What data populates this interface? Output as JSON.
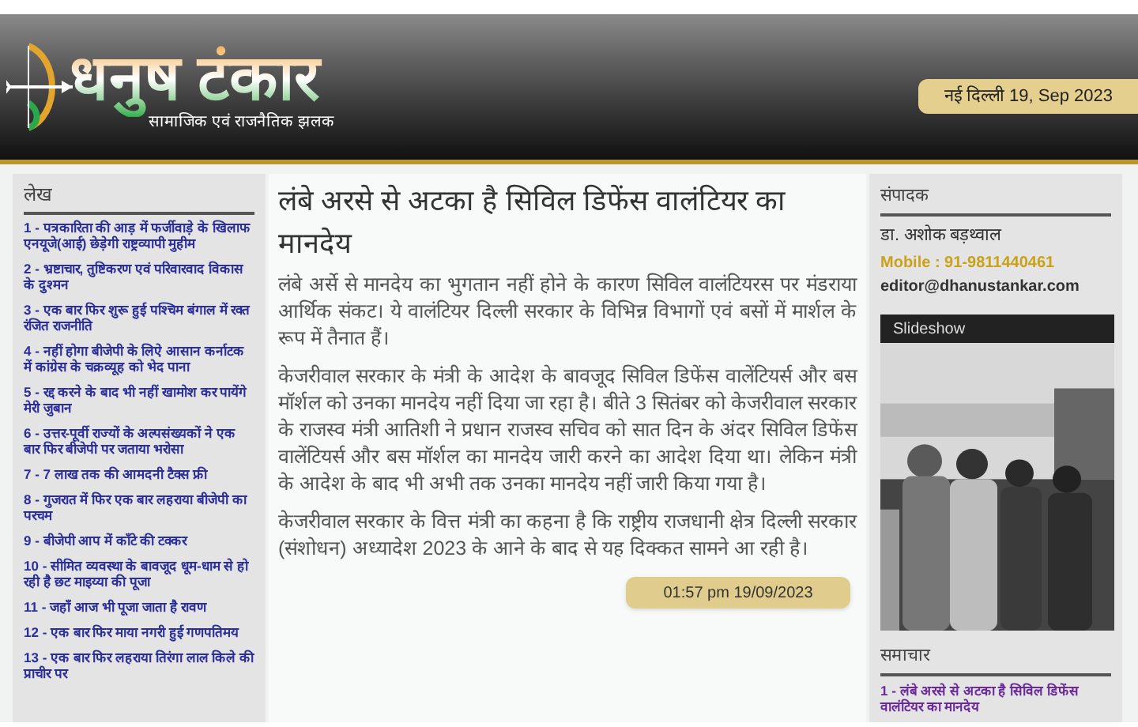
{
  "header": {
    "logo_title": "धनुष टंकार",
    "tagline": "सामाजिक एवं राजनैतिक झलक",
    "dateline": "नई दिल्ली 19, Sep 2023"
  },
  "articles_sidebar": {
    "heading": "लेख",
    "items": [
      "1 - पत्रकारिता की आड़ में फर्जीवाड़े के खिलाफ एनयूजे(आई) छेड़ेगी राष्ट्रव्यापी मुहीम",
      "2 - भ्रष्टाचार, तुष्टिकरण एवं परिवारवाद विकास के दुश्मन",
      "3 - एक बार फिर शुरू हुई पश्चिम बंगाल में रक्त रंजित राजनीति",
      "4 - नहीं होगा बीजेपी के लिऐ आसान कर्नाटक में कांग्रेस के चक्रव्यूह को भेद पाना",
      "5 - रद्द करने के बाद भी नहीं खामोश कर पायेंगे मेरी जुबान",
      "6 - उत्तर-पूर्वी राज्यों के अल्पसंख्यकों ने एक बार फिर बीजेपी पर जताया भरोसा",
      "7 - 7 लाख तक की आमदनी टैक्स फ्री",
      "8 - गुजरात में फिर एक बार लहराया बीजेपी का परचम",
      "9 - बीजेपी आप में काँटे की टक्कर",
      "10 - सीमित व्यवस्था के बावजूद धूम-धाम से हो रही है छट माइय्या की पूजा",
      "11 - जहाँ आज भी पूजा जाता है रावण",
      "12 - एक बार फिर माया नगरी हुई गणपतिमय",
      "13 - एक बार फिर लहराया तिरंगा लाल किले की प्राचीर पर"
    ]
  },
  "article": {
    "title": "लंबे अरसे से अटका है सिविल डिफेंस वालंटियर का मानदेय",
    "paragraphs": [
      "लंबे अर्से से मानदेय का भुगतान नहीं होने के कारण सिविल वालंटियरस पर मंडराया आर्थिक संकट। ये वालंटियर दिल्ली सरकार के विभिन्न विभागों एवं बसों में मार्शल के रूप में तैनात हैं।",
      "केजरीवाल सरकार के मंत्री के आदेश के बावजूद सिविल डिफेंस वालेंटियर्स और बस मॉर्शल को उनका मानदेय नहीं दिया जा रहा है। बीते 3 सितंबर को केजरीवाल सरकार के राजस्व मंत्री आतिशी ने प्रधान राजस्व सचिव को सात दिन के अंदर सिविल डिफेंस वालेंटियर्स और बस मॉर्शल का मानदेय जारी करने का आदेश दिया था। लेकिन मंत्री के आदेश के बाद भी अभी तक उनका मानदेय नहीं जारी किया गया है।",
      "केजरीवाल सरकार के वित्त मंत्री का कहना है कि राष्ट्रीय राजधानी क्षेत्र दिल्ली सरकार (संशोधन) अध्यादेश 2023 के आने के बाद से यह दिक्कत सामने आ रही है।"
    ],
    "timestamp": "01:57 pm 19/09/2023"
  },
  "editor": {
    "heading": "संपादक",
    "name": "डा. अशोक बड़थ्वाल",
    "mobile": "Mobile : 91-9811440461",
    "email": "editor@dhanustankar.com"
  },
  "slideshow": {
    "title": "Slideshow"
  },
  "news": {
    "heading": "समाचार",
    "items": [
      "1 - लंबे अरसे से अटका है सिविल डिफेंस वालंटियर का मानदेय"
    ]
  }
}
